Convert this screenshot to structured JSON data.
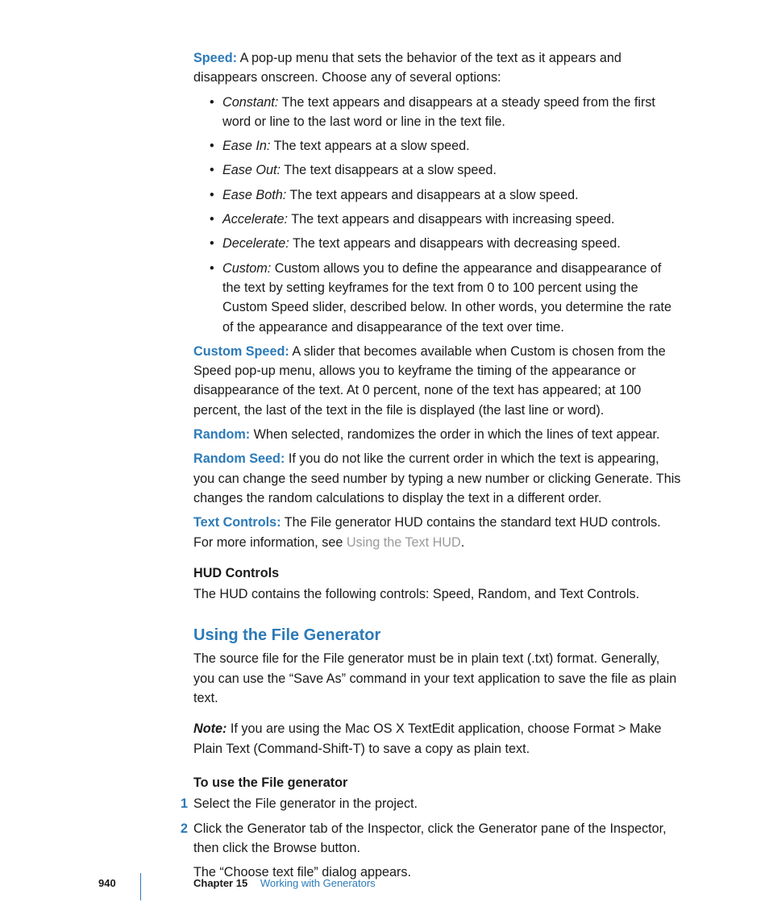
{
  "params": {
    "speed": {
      "label": "Speed:",
      "desc": "A pop-up menu that sets the behavior of the text as it appears and disappears onscreen. Choose any of several options:",
      "options": [
        {
          "term": "Constant:",
          "desc": "The text appears and disappears at a steady speed from the first word or line to the last word or line in the text file."
        },
        {
          "term": "Ease In:",
          "desc": "The text appears at a slow speed."
        },
        {
          "term": "Ease Out:",
          "desc": "The text disappears at a slow speed."
        },
        {
          "term": "Ease Both:",
          "desc": "The text appears and disappears at a slow speed."
        },
        {
          "term": "Accelerate:",
          "desc": "The text appears and disappears with increasing speed."
        },
        {
          "term": "Decelerate:",
          "desc": "The text appears and disappears with decreasing speed."
        },
        {
          "term": "Custom:",
          "desc": "Custom allows you to define the appearance and disappearance of the text by setting keyframes for the text from 0 to 100 percent using the Custom Speed slider, described below. In other words, you determine the rate of the appearance and disappearance of the text over time."
        }
      ]
    },
    "custom_speed": {
      "label": "Custom Speed:",
      "desc": "A slider that becomes available when Custom is chosen from the Speed pop-up menu, allows you to keyframe the timing of the appearance or disappearance of the text. At 0 percent, none of the text has appeared; at 100 percent, the last of the text in the file is displayed (the last line or word)."
    },
    "random": {
      "label": "Random:",
      "desc": "When selected, randomizes the order in which the lines of text appear."
    },
    "random_seed": {
      "label": "Random Seed:",
      "desc": "If you do not like the current order in which the text is appearing, you can change the seed number by typing a new number or clicking Generate. This changes the random calculations to display the text in a different order."
    },
    "text_controls": {
      "label": "Text Controls:",
      "desc_pre": "The File generator HUD contains the standard text HUD controls. For more information, see ",
      "link": "Using the Text HUD",
      "desc_post": "."
    }
  },
  "hud": {
    "heading": "HUD Controls",
    "body": "The HUD contains the following controls: Speed, Random, and Text Controls."
  },
  "section": {
    "title": "Using the File Generator",
    "intro": "The source file for the File generator must be in plain text (.txt) format. Generally, you can use the “Save As” command in your text application to save the file as plain text.",
    "note_label": "Note:",
    "note_body": "If you are using the Mac OS X TextEdit application, choose Format > Make Plain Text (Command-Shift-T) to save a copy as plain text.",
    "task_heading": "To use the File generator",
    "steps": [
      "Select the File generator in the project.",
      "Click the Generator tab of the Inspector, click the Generator pane of the Inspector, then click the Browse button."
    ],
    "step2_follow": "The “Choose text file” dialog appears."
  },
  "footer": {
    "page": "940",
    "chapter_num": "Chapter 15",
    "chapter_title": "Working with Generators"
  }
}
